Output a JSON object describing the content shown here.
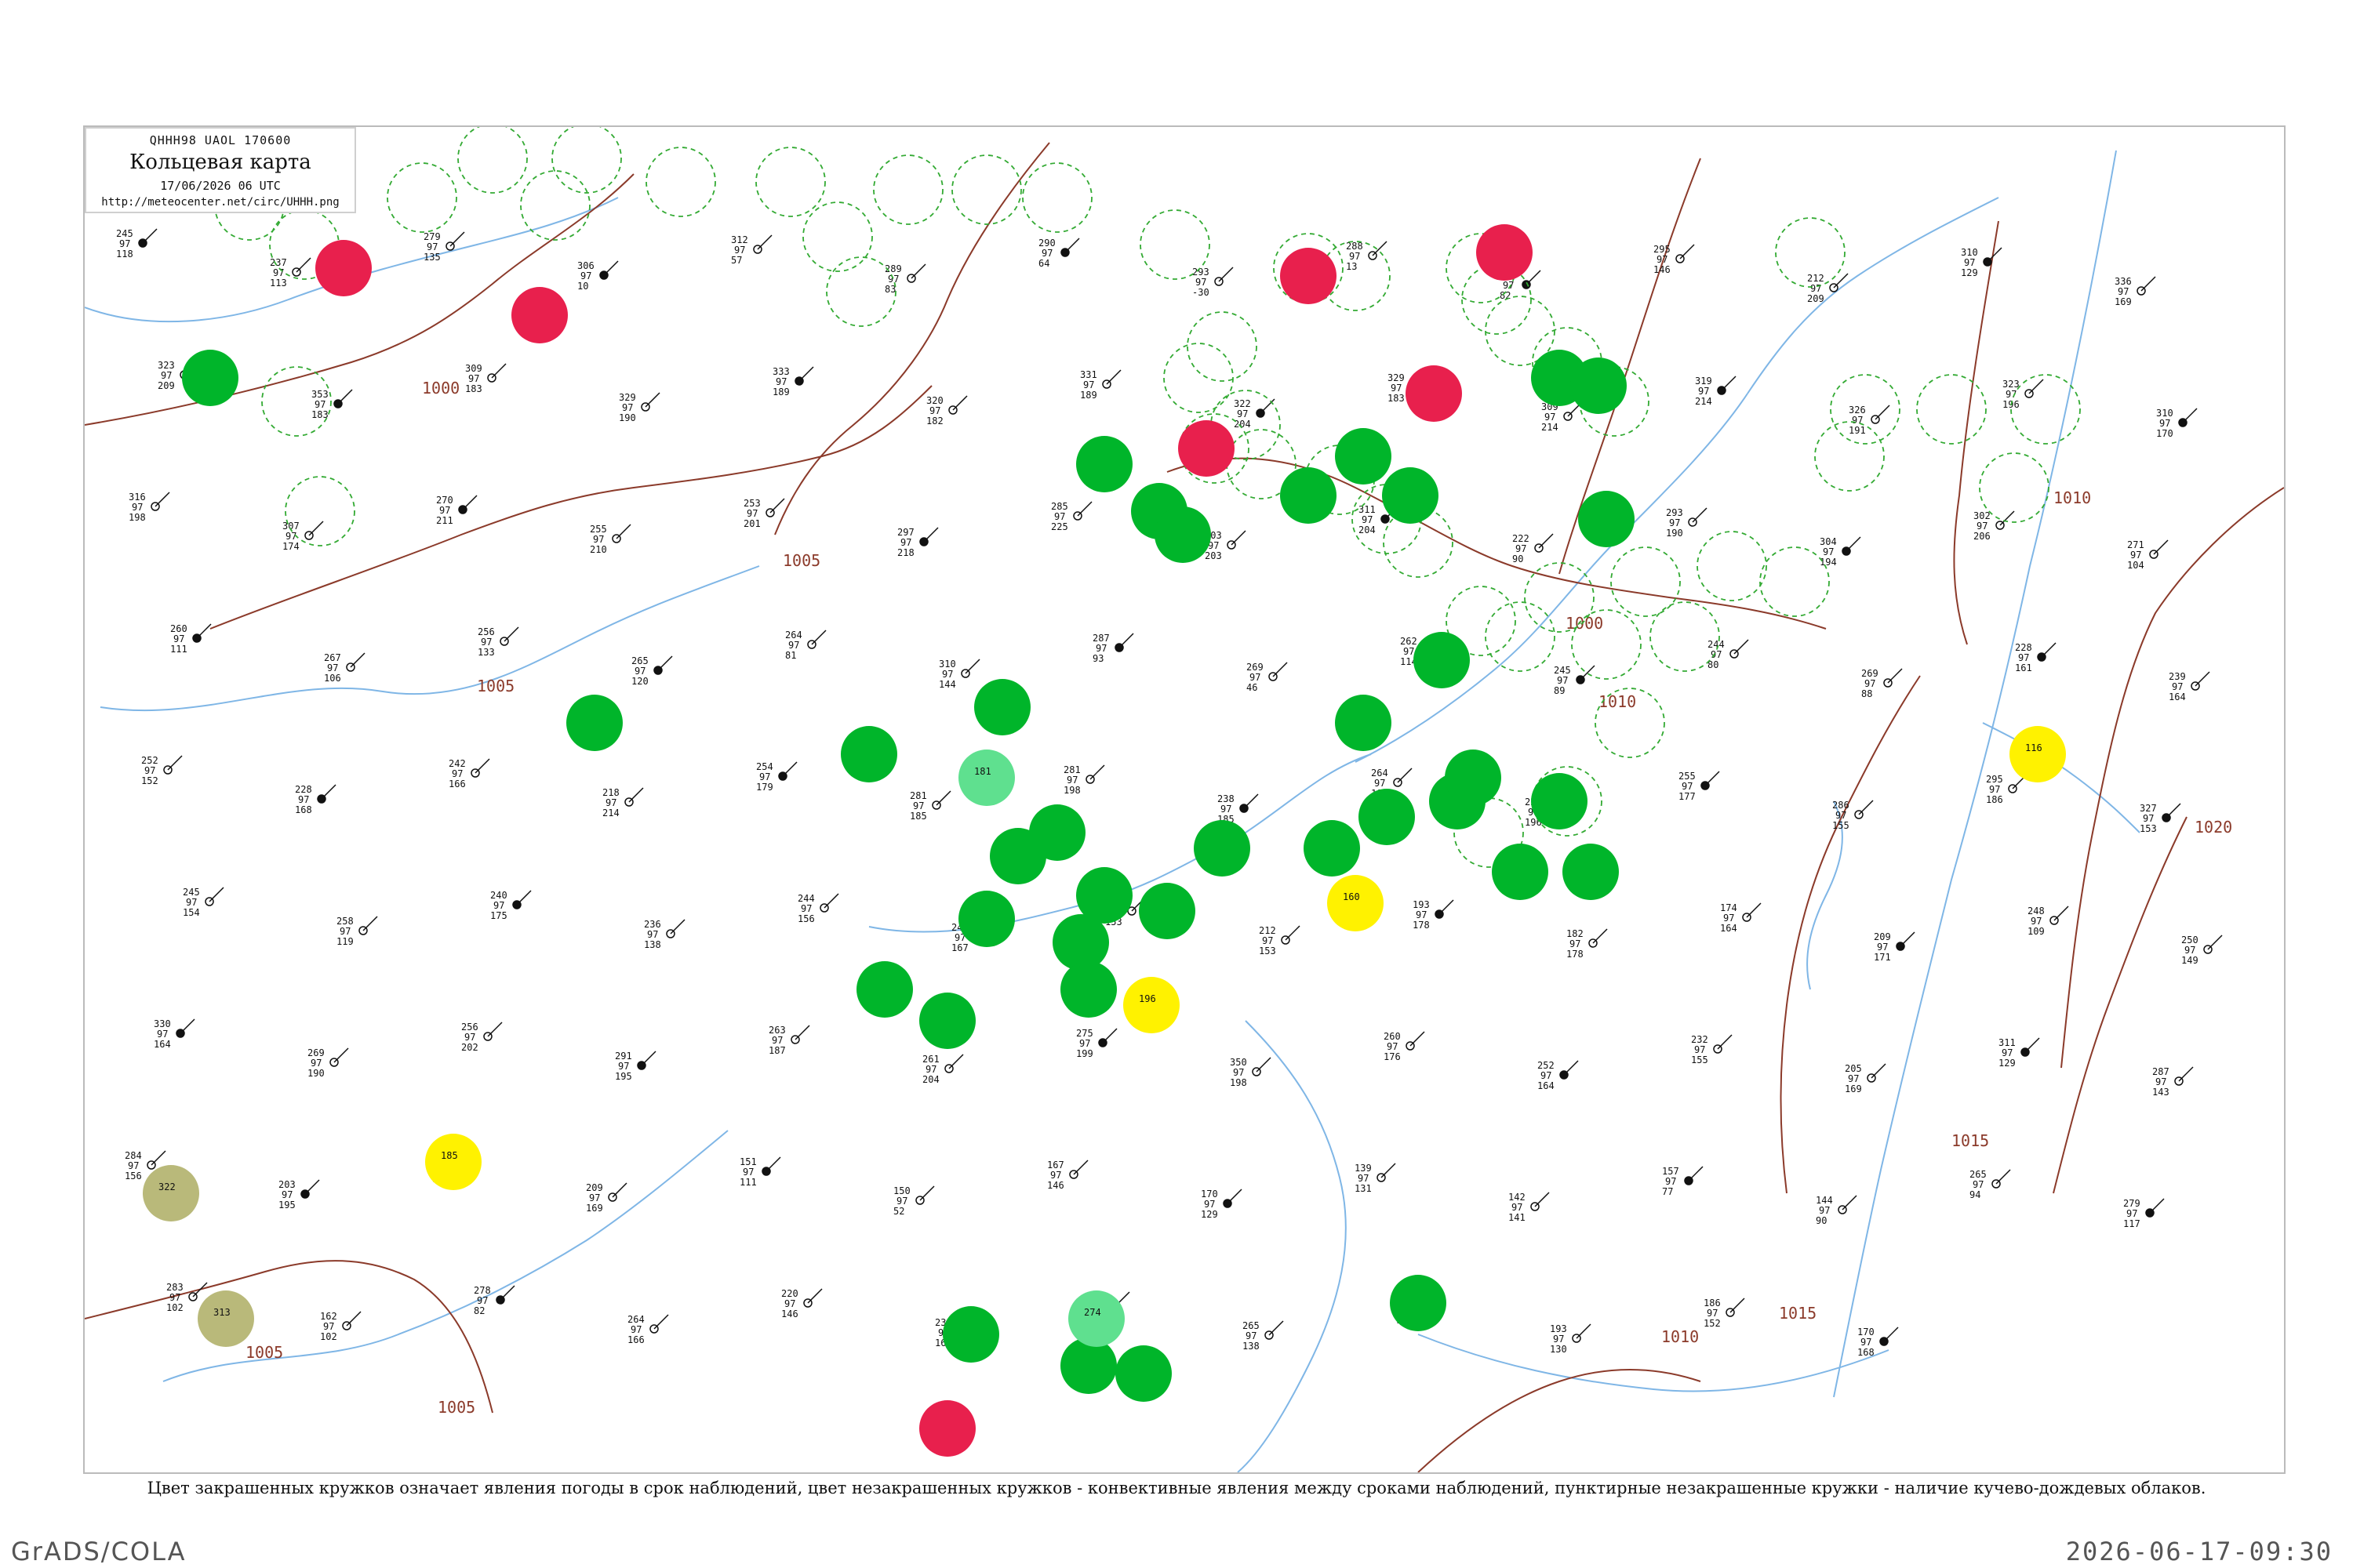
{
  "header": {
    "code": "QHHH98  UAOL  170600",
    "title": "Кольцевая карта",
    "datetime": "17/06/2026 06 UTC",
    "url": "http://meteocenter.net/circ/UHHH.png"
  },
  "caption": "Цвет закрашенных кружков означает явления погоды в срок наблюдений, цвет незакрашенных кружков - конвективные явления между сроками наблюдений, пунктирные незакрашенные кружки - наличие кучево-дождевых облаков.",
  "footer": {
    "left": "GrADS/COLA",
    "right": "2026-06-17-09:30"
  },
  "colors": {
    "rain": "#00b52a",
    "thunder": "#e8204d",
    "showers": "#fff200",
    "drizzle": "#5fe08f",
    "haze": "#b9b97a",
    "cb": "#33aa33",
    "isobar": "#8b3a2a",
    "water": "#7fb6e6"
  },
  "isobars": [
    {
      "label": "1000"
    },
    {
      "label": "1000"
    },
    {
      "label": "1005"
    },
    {
      "label": "1005"
    },
    {
      "label": "1005"
    },
    {
      "label": "1005"
    },
    {
      "label": "1010"
    },
    {
      "label": "1010"
    },
    {
      "label": "1010"
    },
    {
      "label": "1015"
    },
    {
      "label": "1015"
    },
    {
      "label": "1020"
    }
  ],
  "stations": [
    {
      "t": "245",
      "p": "97",
      "d": "118"
    },
    {
      "t": "237",
      "p": "97",
      "d": "113"
    },
    {
      "t": "279",
      "p": "97",
      "d": "135"
    },
    {
      "t": "306",
      "p": "97",
      "d": "10"
    },
    {
      "t": "312",
      "p": "97",
      "d": "57"
    },
    {
      "t": "289",
      "p": "97",
      "d": "83"
    },
    {
      "t": "290",
      "p": "97",
      "d": "64"
    },
    {
      "t": "293",
      "p": "97",
      "d": "-30"
    },
    {
      "t": "288",
      "p": "97",
      "d": "13"
    },
    {
      "t": "279",
      "p": "97",
      "d": "82"
    },
    {
      "t": "295",
      "p": "97",
      "d": "146"
    },
    {
      "t": "212",
      "p": "97",
      "d": "209"
    },
    {
      "t": "310",
      "p": "97",
      "d": "129"
    },
    {
      "t": "336",
      "p": "97",
      "d": "169"
    },
    {
      "t": "323",
      "p": "97",
      "d": "209"
    },
    {
      "t": "353",
      "p": "97",
      "d": "183"
    },
    {
      "t": "309",
      "p": "97",
      "d": "183"
    },
    {
      "t": "329",
      "p": "97",
      "d": "190"
    },
    {
      "t": "333",
      "p": "97",
      "d": "189"
    },
    {
      "t": "320",
      "p": "97",
      "d": "182"
    },
    {
      "t": "331",
      "p": "97",
      "d": "189"
    },
    {
      "t": "322",
      "p": "97",
      "d": "204"
    },
    {
      "t": "329",
      "p": "97",
      "d": "183"
    },
    {
      "t": "309",
      "p": "97",
      "d": "214"
    },
    {
      "t": "319",
      "p": "97",
      "d": "214"
    },
    {
      "t": "326",
      "p": "97",
      "d": "191"
    },
    {
      "t": "323",
      "p": "97",
      "d": "196"
    },
    {
      "t": "310",
      "p": "97",
      "d": "170"
    },
    {
      "t": "316",
      "p": "97",
      "d": "198"
    },
    {
      "t": "307",
      "p": "97",
      "d": "174"
    },
    {
      "t": "270",
      "p": "97",
      "d": "211"
    },
    {
      "t": "255",
      "p": "97",
      "d": "210"
    },
    {
      "t": "253",
      "p": "97",
      "d": "201"
    },
    {
      "t": "297",
      "p": "97",
      "d": "218"
    },
    {
      "t": "285",
      "p": "97",
      "d": "225"
    },
    {
      "t": "303",
      "p": "97",
      "d": "203"
    },
    {
      "t": "311",
      "p": "97",
      "d": "204"
    },
    {
      "t": "222",
      "p": "97",
      "d": "90"
    },
    {
      "t": "293",
      "p": "97",
      "d": "190"
    },
    {
      "t": "304",
      "p": "97",
      "d": "194"
    },
    {
      "t": "302",
      "p": "97",
      "d": "206"
    },
    {
      "t": "271",
      "p": "97",
      "d": "104"
    },
    {
      "t": "260",
      "p": "97",
      "d": "111"
    },
    {
      "t": "267",
      "p": "97",
      "d": "106"
    },
    {
      "t": "256",
      "p": "97",
      "d": "133"
    },
    {
      "t": "265",
      "p": "97",
      "d": "120"
    },
    {
      "t": "264",
      "p": "97",
      "d": "81"
    },
    {
      "t": "310",
      "p": "97",
      "d": "144"
    },
    {
      "t": "287",
      "p": "97",
      "d": "93"
    },
    {
      "t": "269",
      "p": "97",
      "d": "46"
    },
    {
      "t": "262",
      "p": "97",
      "d": "114"
    },
    {
      "t": "245",
      "p": "97",
      "d": "89"
    },
    {
      "t": "244",
      "p": "97",
      "d": "80"
    },
    {
      "t": "269",
      "p": "97",
      "d": "88"
    },
    {
      "t": "228",
      "p": "97",
      "d": "161"
    },
    {
      "t": "239",
      "p": "97",
      "d": "164"
    },
    {
      "t": "252",
      "p": "97",
      "d": "152"
    },
    {
      "t": "228",
      "p": "97",
      "d": "168"
    },
    {
      "t": "242",
      "p": "97",
      "d": "166"
    },
    {
      "t": "218",
      "p": "97",
      "d": "214"
    },
    {
      "t": "254",
      "p": "97",
      "d": "179"
    },
    {
      "t": "281",
      "p": "97",
      "d": "185"
    },
    {
      "t": "281",
      "p": "97",
      "d": "198"
    },
    {
      "t": "238",
      "p": "97",
      "d": "185"
    },
    {
      "t": "264",
      "p": "97",
      "d": "180"
    },
    {
      "t": "228",
      "p": "97",
      "d": "196"
    },
    {
      "t": "255",
      "p": "97",
      "d": "177"
    },
    {
      "t": "286",
      "p": "97",
      "d": "155"
    },
    {
      "t": "295",
      "p": "97",
      "d": "186"
    },
    {
      "t": "327",
      "p": "97",
      "d": "153"
    },
    {
      "t": "245",
      "p": "97",
      "d": "154"
    },
    {
      "t": "258",
      "p": "97",
      "d": "119"
    },
    {
      "t": "240",
      "p": "97",
      "d": "175"
    },
    {
      "t": "236",
      "p": "97",
      "d": "138"
    },
    {
      "t": "244",
      "p": "97",
      "d": "156"
    },
    {
      "t": "242",
      "p": "97",
      "d": "167"
    },
    {
      "t": "225",
      "p": "97",
      "d": "153"
    },
    {
      "t": "212",
      "p": "97",
      "d": "153"
    },
    {
      "t": "193",
      "p": "97",
      "d": "178"
    },
    {
      "t": "182",
      "p": "97",
      "d": "178"
    },
    {
      "t": "174",
      "p": "97",
      "d": "164"
    },
    {
      "t": "209",
      "p": "97",
      "d": "171"
    },
    {
      "t": "248",
      "p": "97",
      "d": "109"
    },
    {
      "t": "250",
      "p": "97",
      "d": "149"
    },
    {
      "t": "330",
      "p": "97",
      "d": "164"
    },
    {
      "t": "269",
      "p": "97",
      "d": "190"
    },
    {
      "t": "256",
      "p": "97",
      "d": "202"
    },
    {
      "t": "291",
      "p": "97",
      "d": "195"
    },
    {
      "t": "263",
      "p": "97",
      "d": "187"
    },
    {
      "t": "261",
      "p": "97",
      "d": "204"
    },
    {
      "t": "275",
      "p": "97",
      "d": "199"
    },
    {
      "t": "350",
      "p": "97",
      "d": "198"
    },
    {
      "t": "260",
      "p": "97",
      "d": "176"
    },
    {
      "t": "252",
      "p": "97",
      "d": "164"
    },
    {
      "t": "232",
      "p": "97",
      "d": "155"
    },
    {
      "t": "205",
      "p": "97",
      "d": "169"
    },
    {
      "t": "311",
      "p": "97",
      "d": "129"
    },
    {
      "t": "287",
      "p": "97",
      "d": "143"
    },
    {
      "t": "284",
      "p": "97",
      "d": "156"
    },
    {
      "t": "203",
      "p": "97",
      "d": "195"
    },
    {
      "t": "193",
      "p": "97",
      "d": "130"
    },
    {
      "t": "209",
      "p": "97",
      "d": "169"
    },
    {
      "t": "151",
      "p": "97",
      "d": "111"
    },
    {
      "t": "150",
      "p": "97",
      "d": "52"
    },
    {
      "t": "167",
      "p": "97",
      "d": "146"
    },
    {
      "t": "170",
      "p": "97",
      "d": "129"
    },
    {
      "t": "139",
      "p": "97",
      "d": "131"
    },
    {
      "t": "142",
      "p": "97",
      "d": "141"
    },
    {
      "t": "157",
      "p": "97",
      "d": "77"
    },
    {
      "t": "144",
      "p": "97",
      "d": "90"
    },
    {
      "t": "265",
      "p": "97",
      "d": "94"
    },
    {
      "t": "279",
      "p": "97",
      "d": "117"
    },
    {
      "t": "283",
      "p": "97",
      "d": "102"
    },
    {
      "t": "162",
      "p": "97",
      "d": "102"
    },
    {
      "t": "278",
      "p": "97",
      "d": "82"
    },
    {
      "t": "264",
      "p": "97",
      "d": "166"
    },
    {
      "t": "220",
      "p": "97",
      "d": "146"
    },
    {
      "t": "231",
      "p": "97",
      "d": "167"
    },
    {
      "t": "289",
      "p": "97",
      "d": "147"
    },
    {
      "t": "265",
      "p": "97",
      "d": "138"
    },
    {
      "t": "271",
      "p": "97",
      "d": "94"
    },
    {
      "t": "193",
      "p": "97",
      "d": "130"
    },
    {
      "t": "186",
      "p": "97",
      "d": "152"
    },
    {
      "t": "170",
      "p": "97",
      "d": "168"
    }
  ],
  "symbols": [
    {
      "kind": "rain",
      "label": ""
    },
    {
      "kind": "rain",
      "label": ""
    },
    {
      "kind": "rain",
      "label": ""
    },
    {
      "kind": "rain",
      "label": ""
    },
    {
      "kind": "rain",
      "label": ""
    },
    {
      "kind": "rain",
      "label": ""
    },
    {
      "kind": "rain",
      "label": ""
    },
    {
      "kind": "rain",
      "label": ""
    },
    {
      "kind": "rain",
      "label": ""
    },
    {
      "kind": "rain",
      "label": ""
    },
    {
      "kind": "rain",
      "label": ""
    },
    {
      "kind": "rain",
      "label": ""
    },
    {
      "kind": "rain",
      "label": ""
    },
    {
      "kind": "rain",
      "label": ""
    },
    {
      "kind": "rain",
      "label": ""
    },
    {
      "kind": "rain",
      "label": ""
    },
    {
      "kind": "rain",
      "label": ""
    },
    {
      "kind": "rain",
      "label": ""
    },
    {
      "kind": "rain",
      "label": ""
    },
    {
      "kind": "rain",
      "label": ""
    },
    {
      "kind": "rain",
      "label": ""
    },
    {
      "kind": "rain",
      "label": ""
    },
    {
      "kind": "rain",
      "label": ""
    },
    {
      "kind": "rain",
      "label": ""
    },
    {
      "kind": "rain",
      "label": ""
    },
    {
      "kind": "rain",
      "label": ""
    },
    {
      "kind": "rain",
      "label": ""
    },
    {
      "kind": "rain",
      "label": ""
    },
    {
      "kind": "rain",
      "label": ""
    },
    {
      "kind": "rain",
      "label": ""
    },
    {
      "kind": "rain",
      "label": ""
    },
    {
      "kind": "rain",
      "label": ""
    },
    {
      "kind": "rain",
      "label": ""
    },
    {
      "kind": "rain",
      "label": ""
    },
    {
      "kind": "rain",
      "label": ""
    },
    {
      "kind": "rain",
      "label": ""
    },
    {
      "kind": "thunder",
      "label": ""
    },
    {
      "kind": "thunder",
      "label": ""
    },
    {
      "kind": "thunder",
      "label": ""
    },
    {
      "kind": "thunder",
      "label": ""
    },
    {
      "kind": "thunder",
      "label": ""
    },
    {
      "kind": "thunder",
      "label": ""
    },
    {
      "kind": "thunder",
      "label": ""
    },
    {
      "kind": "showers",
      "label": "185"
    },
    {
      "kind": "showers",
      "label": "160"
    },
    {
      "kind": "showers",
      "label": "196"
    },
    {
      "kind": "showers",
      "label": "116"
    },
    {
      "kind": "drizzle",
      "label": "181"
    },
    {
      "kind": "drizzle",
      "label": "274"
    },
    {
      "kind": "haze",
      "label": "322"
    },
    {
      "kind": "haze",
      "label": "313"
    }
  ],
  "cb_rings": [
    {},
    {},
    {},
    {},
    {},
    {},
    {},
    {},
    {},
    {},
    {},
    {},
    {},
    {},
    {},
    {},
    {},
    {},
    {},
    {},
    {},
    {},
    {},
    {},
    {},
    {},
    {},
    {},
    {},
    {},
    {},
    {},
    {},
    {},
    {},
    {},
    {},
    {},
    {},
    {},
    {},
    {},
    {},
    {},
    {},
    {},
    {},
    {}
  ]
}
